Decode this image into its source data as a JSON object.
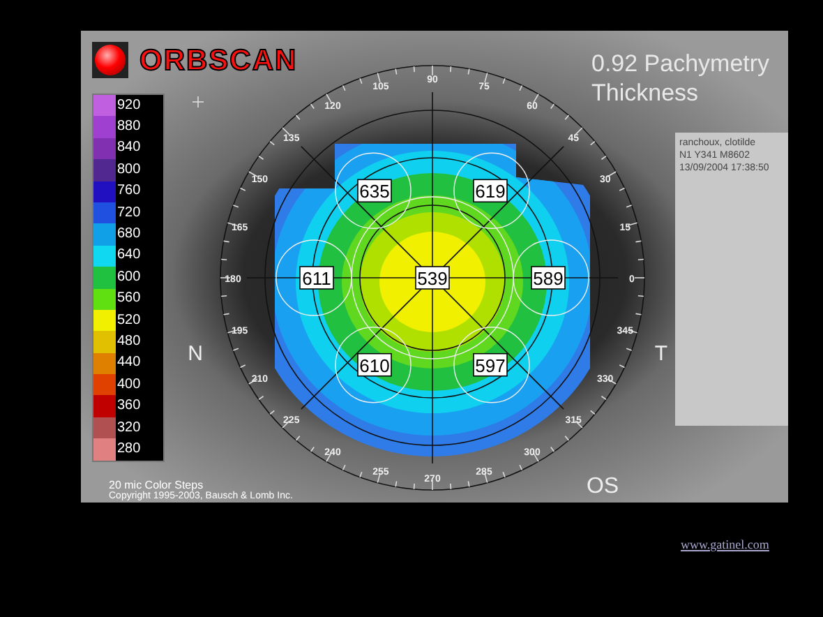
{
  "logo": {
    "text": "ORBSCAN"
  },
  "title": {
    "lines": [
      "0.92 Pachymetry",
      "Thickness"
    ]
  },
  "legend": {
    "items": [
      {
        "label": "920",
        "color": "#c060e0"
      },
      {
        "label": "880",
        "color": "#a040d0"
      },
      {
        "label": "840",
        "color": "#8030b0"
      },
      {
        "label": "800",
        "color": "#502890"
      },
      {
        "label": "760",
        "color": "#2010c0"
      },
      {
        "label": "720",
        "color": "#2050e0"
      },
      {
        "label": "680",
        "color": "#10a0e8"
      },
      {
        "label": "640",
        "color": "#10d8f0"
      },
      {
        "label": "600",
        "color": "#20c040"
      },
      {
        "label": "560",
        "color": "#60e010"
      },
      {
        "label": "520",
        "color": "#f0f000"
      },
      {
        "label": "480",
        "color": "#e0c000"
      },
      {
        "label": "440",
        "color": "#e08000"
      },
      {
        "label": "400",
        "color": "#e04000"
      },
      {
        "label": "360",
        "color": "#c00000"
      },
      {
        "label": "320",
        "color": "#b05050"
      },
      {
        "label": "280",
        "color": "#e08080"
      }
    ],
    "caption": "20 mic Color Steps"
  },
  "copyright": "Copyright 1995-2003, Bausch & Lomb Inc.",
  "patient_info": [
    "ranchoux, clotilde",
    "N1 Y341 M8602",
    "13/09/2004 17:38:50"
  ],
  "map": {
    "angle_labels": [
      "0",
      "15",
      "30",
      "45",
      "60",
      "75",
      "90",
      "105",
      "120",
      "135",
      "150",
      "165",
      "180",
      "195",
      "210",
      "225",
      "240",
      "255",
      "270",
      "285",
      "300",
      "315",
      "330",
      "345"
    ],
    "readings": [
      {
        "kind": "ring",
        "value": "635"
      },
      {
        "kind": "ring",
        "value": "619"
      },
      {
        "kind": "ring",
        "value": "611"
      },
      {
        "kind": "center",
        "value": "539"
      },
      {
        "kind": "ring",
        "value": "589"
      },
      {
        "kind": "ring",
        "value": "610"
      },
      {
        "kind": "ring",
        "value": "597"
      }
    ],
    "nasal": "N",
    "temporal": "T",
    "eye": "OS"
  },
  "footer_link": "www.gatinel.com"
}
